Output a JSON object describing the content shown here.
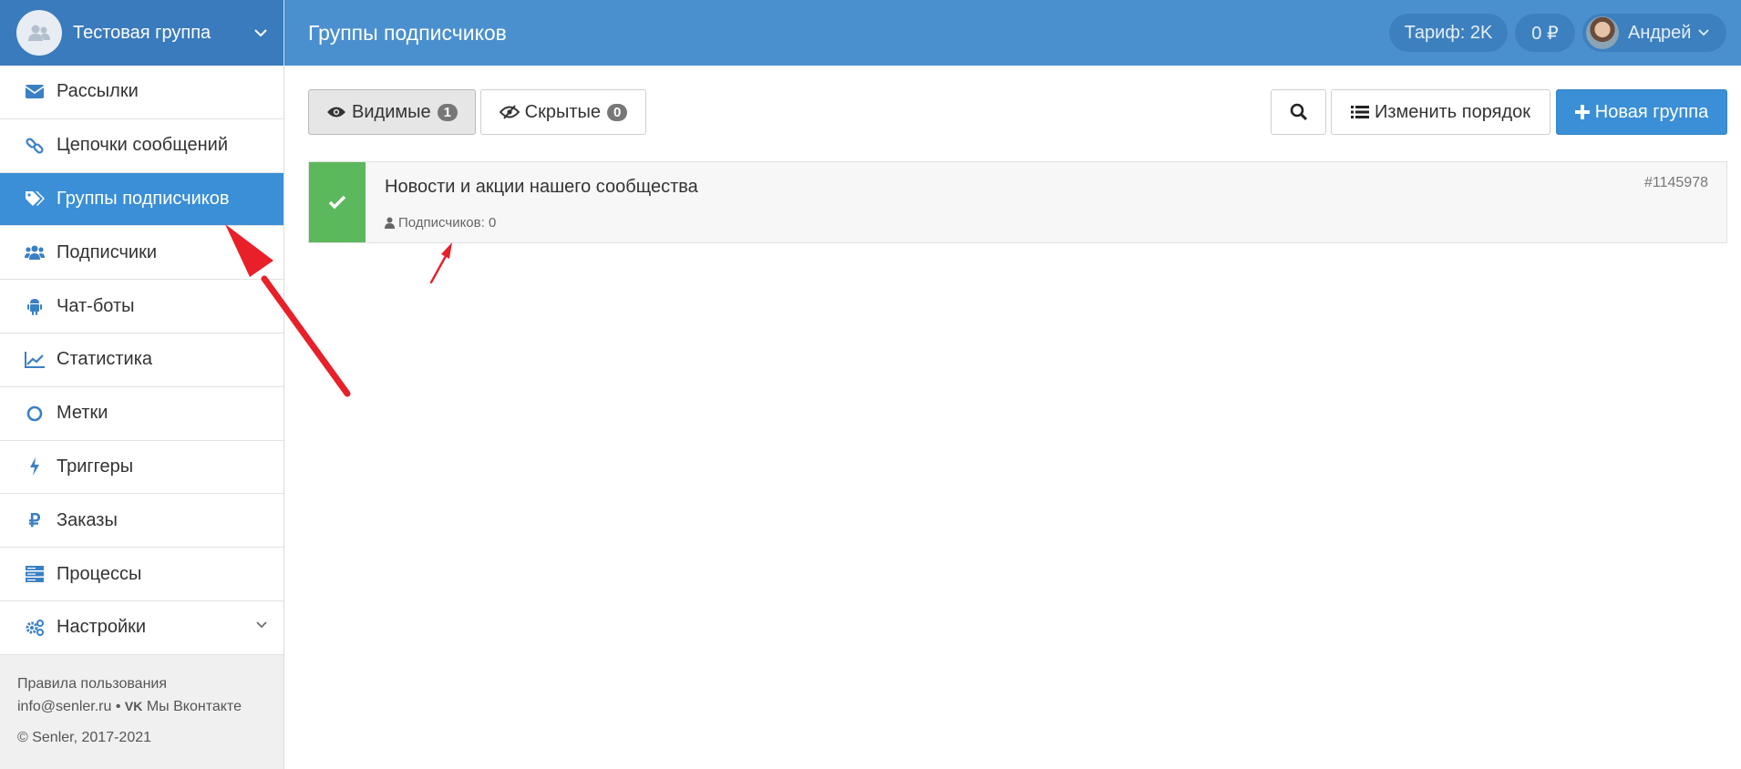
{
  "sidebar": {
    "group_name": "Тестовая группа",
    "items": [
      {
        "label": "Рассылки",
        "icon": "envelope-icon"
      },
      {
        "label": "Цепочки сообщений",
        "icon": "chain-icon"
      },
      {
        "label": "Группы подписчиков",
        "icon": "tags-icon",
        "active": true
      },
      {
        "label": "Подписчики",
        "icon": "users-icon"
      },
      {
        "label": "Чат-боты",
        "icon": "android-icon"
      },
      {
        "label": "Статистика",
        "icon": "line-chart-icon"
      },
      {
        "label": "Метки",
        "icon": "circle-icon"
      },
      {
        "label": "Триггеры",
        "icon": "bolt-icon"
      },
      {
        "label": "Заказы",
        "icon": "ruble-icon"
      },
      {
        "label": "Процессы",
        "icon": "server-icon"
      },
      {
        "label": "Настройки",
        "icon": "cogs-icon"
      }
    ],
    "footer": {
      "terms": "Правила пользования",
      "email": "info@senler.ru",
      "separator": "•",
      "vk": "Мы Вконтакте",
      "copyright": "© Senler, 2017-2021"
    }
  },
  "header": {
    "title": "Группы подписчиков",
    "tariff": "Тариф: 2K",
    "balance": "0 ₽",
    "user": "Андрей"
  },
  "toolbar": {
    "visible_label": "Видимые",
    "visible_count": "1",
    "hidden_label": "Скрытые",
    "hidden_count": "0",
    "reorder_label": "Изменить порядок",
    "new_label": "Новая группа"
  },
  "groups": [
    {
      "name": "Новости и акции нашего сообщества",
      "subscribers": "Подписчиков: 0",
      "id": "#1145978"
    }
  ],
  "colors": {
    "header_blue": "#4a90cf",
    "active_blue": "#3a8fd6",
    "check_green": "#5cb85c",
    "annotation_red": "#e8202a"
  }
}
